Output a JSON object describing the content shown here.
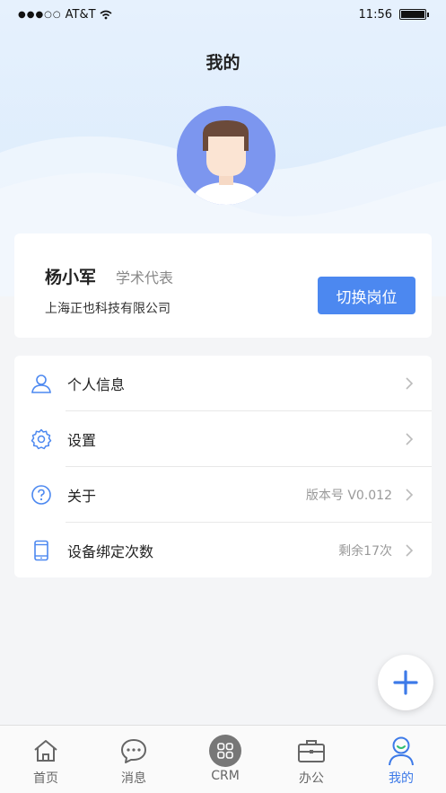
{
  "status_bar": {
    "carrier": "AT&T",
    "time": "11:56"
  },
  "page": {
    "title": "我的"
  },
  "profile": {
    "name": "杨小军",
    "role": "学术代表",
    "company": "上海正也科技有限公司",
    "switch_label": "切换岗位"
  },
  "menu": {
    "items": [
      {
        "label": "个人信息",
        "value": "",
        "icon": "user-icon"
      },
      {
        "label": "设置",
        "value": "",
        "icon": "gear-icon"
      },
      {
        "label": "关于",
        "value": "版本号 V0.012",
        "icon": "question-icon"
      },
      {
        "label": "设备绑定次数",
        "value": "剩余17次",
        "icon": "phone-icon"
      }
    ]
  },
  "fab": {
    "icon": "plus-icon"
  },
  "tabbar": {
    "tabs": [
      {
        "label": "首页",
        "icon": "home-icon",
        "active": false
      },
      {
        "label": "消息",
        "icon": "message-icon",
        "active": false
      },
      {
        "label": "CRM",
        "icon": "crm-grid-icon",
        "active": false
      },
      {
        "label": "办公",
        "icon": "briefcase-icon",
        "active": false
      },
      {
        "label": "我的",
        "icon": "profile-icon",
        "active": true
      }
    ]
  },
  "colors": {
    "accent": "#4c88f0",
    "active_tab": "#3d7ae8",
    "background": "#f4f5f7"
  }
}
